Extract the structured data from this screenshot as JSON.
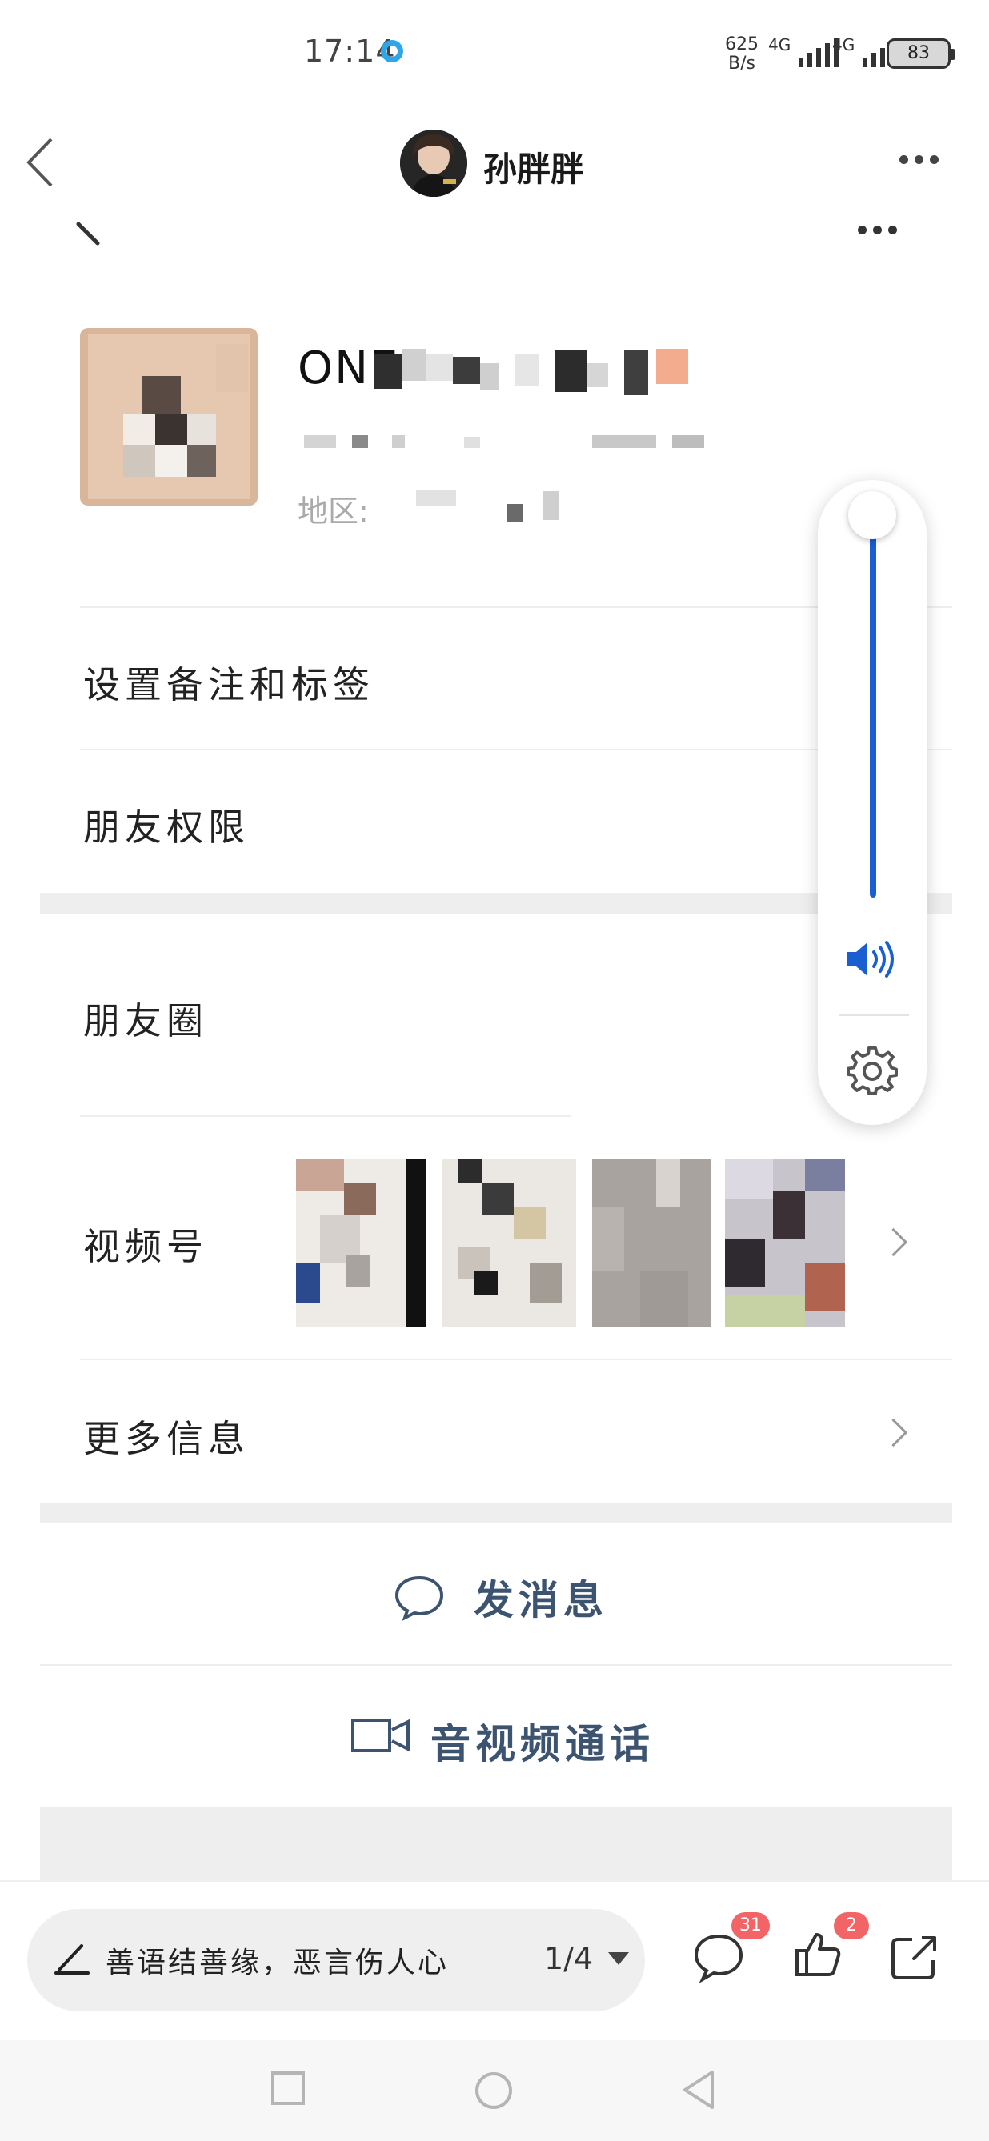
{
  "status_bar": {
    "time": "17:14",
    "net_speed_value": "625",
    "net_speed_unit": "B/s",
    "signal1": "4G",
    "signal2": "4G",
    "battery": "83"
  },
  "header": {
    "author_name": "孙胖胖"
  },
  "profile": {
    "name_prefix": "ONE",
    "region_label": "地区:",
    "rows": {
      "remark_tag": "设置备注和标签",
      "permissions": "朋友权限",
      "moments": "朋友圈",
      "channels": "视频号",
      "more_info": "更多信息"
    },
    "actions": {
      "send_message": "发消息",
      "video_call": "音视频通话"
    }
  },
  "volume": {
    "level_fraction": 1.0
  },
  "bottom_bar": {
    "comment_placeholder": "善语结善缘，恶言伤人心",
    "page_indicator": "1/4",
    "comment_count": "31",
    "like_count": "2"
  },
  "icons": [
    "back-arrow-icon",
    "more-icon",
    "chevron-right-icon",
    "chat-bubble-icon",
    "video-camera-icon",
    "speaker-icon",
    "gear-icon",
    "pencil-icon",
    "comment-icon",
    "thumbs-up-icon",
    "share-icon",
    "square-nav-icon",
    "circle-nav-icon",
    "triangle-nav-icon"
  ],
  "colors": {
    "accent_blue": "#1a5fd1",
    "badge_red": "#f26466",
    "action_text": "#3c5470",
    "status_ring": "#2ea7ea"
  }
}
